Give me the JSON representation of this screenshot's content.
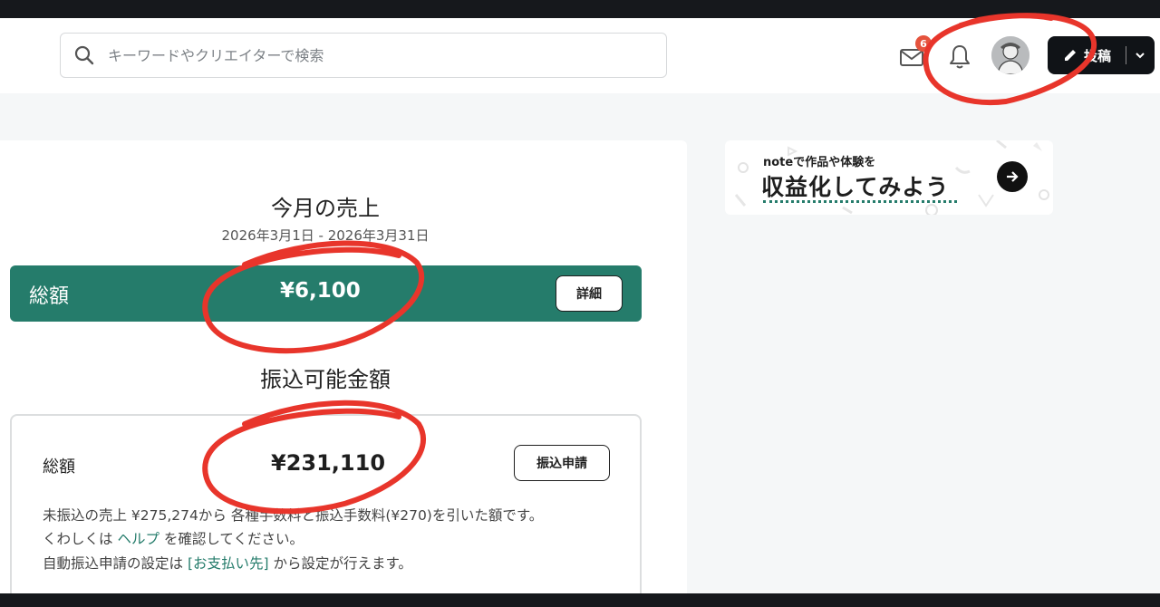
{
  "header": {
    "search_placeholder": "キーワードやクリエイターで検索",
    "mail_badge": "6",
    "post_label": "投稿"
  },
  "sales": {
    "title": "今月の売上",
    "period": "2026年3月1日 - 2026年3月31日",
    "total_label": "総額",
    "total_amount": "¥6,100",
    "detail_button": "詳細"
  },
  "transfer": {
    "title": "振込可能金額",
    "total_label": "総額",
    "total_amount": "¥231,110",
    "apply_button": "振込申請",
    "note_line1": "未振込の売上 ¥275,274から 各種手数料と振込手数料(¥270)を引いた額です。",
    "note_line2_pre": "くわしくは ",
    "note_line2_link": "ヘルプ",
    "note_line2_post": " を確認してください。",
    "note_line3_pre": "自動振込申請の設定は ",
    "note_line3_link": "[お支払い先]",
    "note_line3_post": " から設定が行えます。"
  },
  "promo": {
    "small_text": "noteで作品や体験を",
    "big_text": "収益化してみよう"
  },
  "colors": {
    "brand_green": "#257c6b",
    "annotation_red": "#e8352b",
    "badge_red": "#e5533d"
  }
}
